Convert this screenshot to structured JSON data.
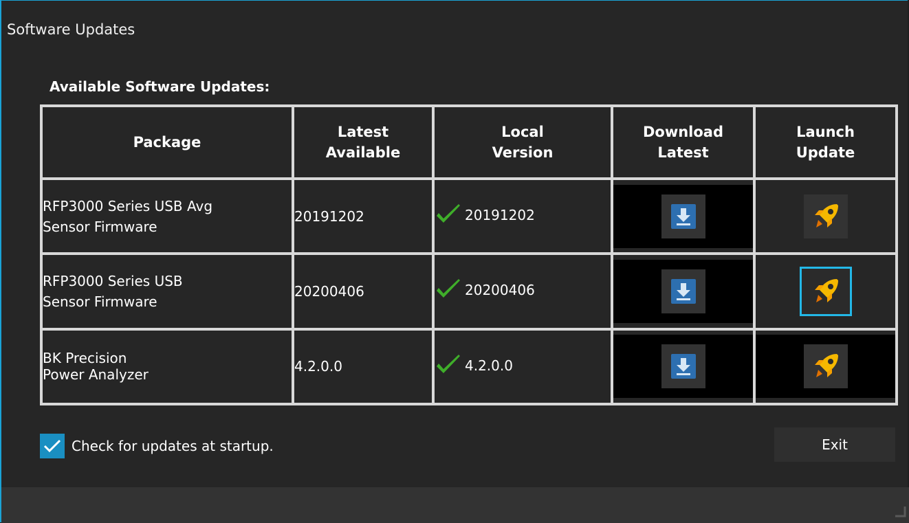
{
  "window": {
    "title": "Software Updates"
  },
  "section_heading": "Available Software Updates:",
  "table": {
    "columns": [
      "Package",
      "Latest\nAvailable",
      "Local\nVersion",
      "Download\nLatest",
      "Launch\nUpdate"
    ],
    "rows": [
      {
        "package_line1": "RFP3000 Series USB Avg",
        "package_line2": "Sensor Firmware",
        "latest": "20191202",
        "local": "20191202",
        "download_icon": "download-icon",
        "launch_icon": "rocket-icon"
      },
      {
        "package_line1": "RFP3000 Series USB",
        "package_line2": "Sensor Firmware",
        "latest": "20200406",
        "local": "20200406",
        "download_icon": "download-icon",
        "launch_icon": "rocket-icon"
      },
      {
        "package_line1": "BK Precision",
        "package_line2": "Power Analyzer",
        "latest": "4.2.0.0",
        "local": "4.2.0.0",
        "download_icon": "download-icon",
        "launch_icon": "rocket-icon"
      }
    ]
  },
  "startup_checkbox": {
    "label": "Check for updates at startup.",
    "checked": true
  },
  "exit_button": "Exit",
  "colors": {
    "accent": "#1aa3d6",
    "check_green": "#3fae2a",
    "rocket": "#f5b800",
    "download_tile": "#2d6fb0"
  }
}
